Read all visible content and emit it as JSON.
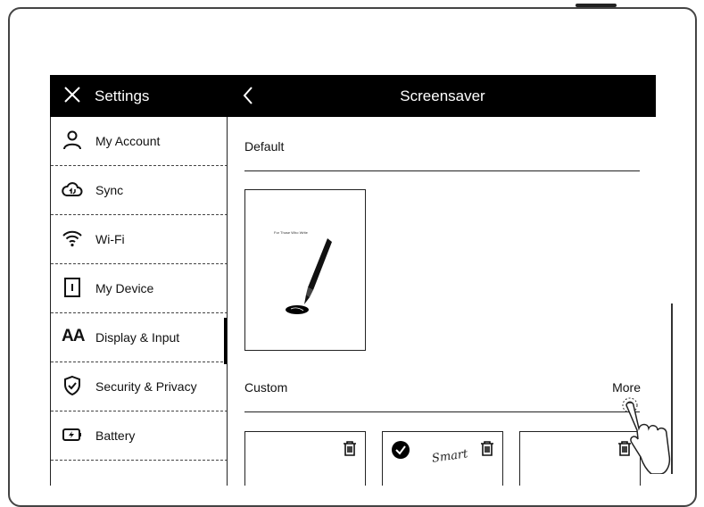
{
  "header": {
    "settings_title": "Settings",
    "page_title": "Screensaver"
  },
  "sidebar": {
    "items": [
      {
        "label": "My Account",
        "icon": "account-icon"
      },
      {
        "label": "Sync",
        "icon": "cloud-sync-icon"
      },
      {
        "label": "Wi-Fi",
        "icon": "wifi-icon"
      },
      {
        "label": "My Device",
        "icon": "device-icon"
      },
      {
        "label": "Display & Input",
        "icon": "font-size-icon",
        "active": true,
        "glyph": "AA"
      },
      {
        "label": "Security & Privacy",
        "icon": "shield-icon"
      },
      {
        "label": "Battery",
        "icon": "battery-icon"
      }
    ]
  },
  "main": {
    "default_section": {
      "title": "Default",
      "thumbnail_caption": "For Those Who Write"
    },
    "custom_section": {
      "title": "Custom",
      "more_label": "More",
      "thumbnails": [
        {
          "selected": false,
          "icon": "trash-icon"
        },
        {
          "selected": true,
          "icon": "trash-icon",
          "handwriting": "Smart"
        },
        {
          "selected": false,
          "icon": "trash-icon"
        }
      ]
    }
  },
  "colors": {
    "topbar_bg": "#000000",
    "topbar_text": "#ffffff",
    "divider": "#222222"
  }
}
